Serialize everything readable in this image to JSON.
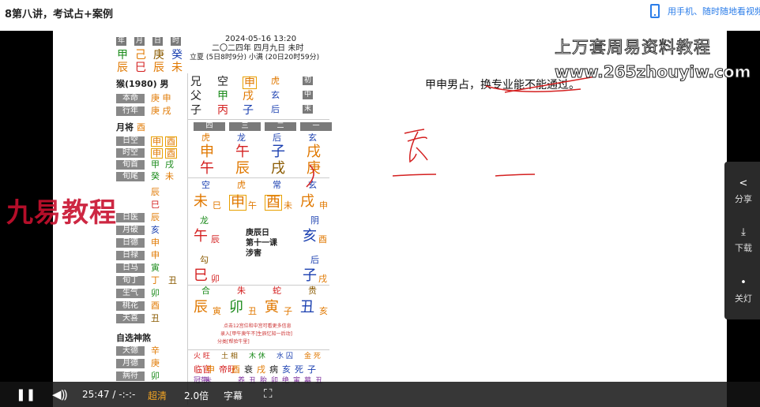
{
  "page": {
    "lesson_title": "8第八讲，考试占+案例",
    "mobile_link": "用手机、随时随地看视频"
  },
  "slide": {
    "brand_title": "上万套周易资料教程",
    "brand_url": "www.265zhouyiw.com",
    "watermark": "九易教程",
    "question": "甲申男占，换专业能不能通过。",
    "chart": {
      "pillar_headers": [
        "年",
        "月",
        "日",
        "时"
      ],
      "stems": [
        "甲",
        "己",
        "庚",
        "癸"
      ],
      "branches": [
        "辰",
        "巳",
        "辰",
        "未"
      ],
      "datetime": "2024-05-16 13:20",
      "lunar": "二〇二四年 四月九日 未时",
      "terms": "立夏 (5日8时9分) 小满 (20日20时59分)",
      "person": "猴(1980) 男",
      "benming_label": "本命",
      "benming": [
        "庚",
        "申"
      ],
      "xingnian_label": "行年",
      "xingnian": [
        "庚",
        "戌"
      ],
      "yuejiang_label": "月将",
      "yuejiang": "酉",
      "kong_rows": [
        {
          "label": "日空",
          "a": "申",
          "b": "酉"
        },
        {
          "label": "时空",
          "a": "申",
          "b": "酉"
        },
        {
          "label": "旬首",
          "a": "甲",
          "b": "戌"
        },
        {
          "label": "旬尾",
          "a": "癸",
          "b": "未"
        }
      ],
      "shensha_rows": [
        {
          "label": "",
          "v": "辰"
        },
        {
          "label": "",
          "v": "巳"
        },
        {
          "label": "日医",
          "v": "辰"
        },
        {
          "label": "月破",
          "v": "亥"
        },
        {
          "label": "日德",
          "v": "申"
        },
        {
          "label": "日禄",
          "v": "申"
        },
        {
          "label": "日马",
          "v": "寅"
        },
        {
          "label": "旬丁",
          "v": "丁",
          "v2": "丑"
        },
        {
          "label": "生气",
          "v": "卯"
        },
        {
          "label": "桃花",
          "v": "酉"
        },
        {
          "label": "天喜",
          "v": "丑"
        }
      ],
      "zixuan_title": "自选神煞",
      "zixuan_rows": [
        {
          "label": "天德",
          "v": "辛"
        },
        {
          "label": "月德",
          "v": "庚"
        },
        {
          "label": "病符",
          "v": "卯"
        }
      ],
      "sanchuan": [
        {
          "liuqin": "兄",
          "dun": "空",
          "zhi": "申",
          "jiang": "虎",
          "pos": "初"
        },
        {
          "liuqin": "父",
          "dun": "甲",
          "zhi": "戌",
          "jiang": "玄",
          "pos": "中"
        },
        {
          "liuqin": "子",
          "dun": "丙",
          "zhi": "子",
          "jiang": "后",
          "pos": "末"
        }
      ],
      "ke_headers": [
        "四",
        "三",
        "二",
        "一"
      ],
      "ke_jiang": [
        "虎",
        "龙",
        "后",
        "玄"
      ],
      "ke_top": [
        "申",
        "午",
        "子",
        "戌"
      ],
      "ke_bottom": [
        "午",
        "辰",
        "戌",
        "庚"
      ],
      "tianpan_top_jiang": [
        "空",
        "虎",
        "常",
        "玄"
      ],
      "tianpan_top": [
        {
          "zhi": "未",
          "sub": "巳"
        },
        {
          "zhi": "申",
          "sub": "午"
        },
        {
          "zhi": "酉",
          "sub": "未"
        },
        {
          "zhi": "戌",
          "sub": "申"
        }
      ],
      "left_side": [
        {
          "jiang": "龙",
          "zhi": "午",
          "sub": "辰"
        },
        {
          "jiang": "勾",
          "zhi": "巳",
          "sub": "卯"
        }
      ],
      "right_side": [
        {
          "jiang": "阴",
          "zhi": "亥",
          "sub": "酉"
        },
        {
          "jiang": "后",
          "zhi": "子",
          "sub": "戌"
        }
      ],
      "center": [
        "庚辰日",
        "第十一课",
        "涉害"
      ],
      "tianpan_bottom_jiang": [
        "合",
        "朱",
        "蛇",
        "贵"
      ],
      "tianpan_bottom": [
        {
          "zhi": "辰",
          "sub": "寅"
        },
        {
          "zhi": "卯",
          "sub": "丑"
        },
        {
          "zhi": "寅",
          "sub": "子"
        },
        {
          "zhi": "丑",
          "sub": "亥"
        }
      ],
      "hint_lines": [
        "点击12宫位和中宫可看更多信息",
        "录入[甲午庚午不]生辰忆知一后动]",
        "分类[帮验牛里]"
      ],
      "wuxing_row": [
        "火 旺",
        "土 相",
        "木 休",
        "水 囚",
        "金 死"
      ],
      "changsheng_row": [
        "临官",
        "申",
        "帝旺",
        "酉",
        "衰",
        "戌",
        "病",
        "亥",
        "死",
        "子"
      ],
      "last_row": [
        "冠带",
        "未",
        "",
        "",
        "养",
        "丑",
        "胎",
        "卯",
        "绝",
        "寅",
        "墓",
        "丑"
      ]
    }
  },
  "side_panel": {
    "share": "分享",
    "download": "下载",
    "lights_off": "关灯"
  },
  "controls": {
    "time": "25:47 / -:-:-",
    "quality": "超清",
    "speed": "2.0倍",
    "subtitle": "字幕"
  }
}
